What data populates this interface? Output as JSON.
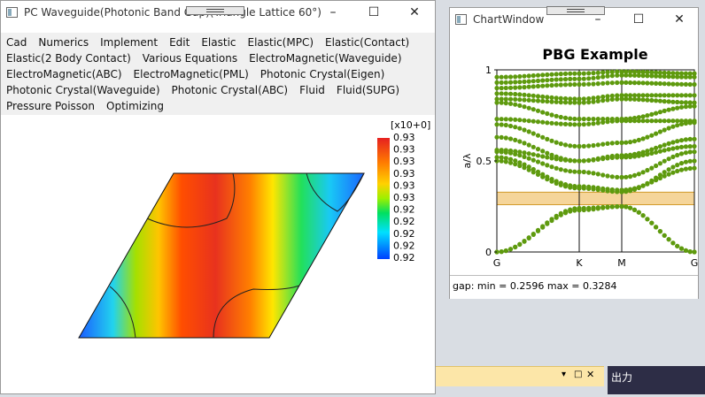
{
  "main_window": {
    "title": "PC Waveguide(Photonic Band Gap)(Triangle Lattice 60°) - I...",
    "menu_rows": [
      [
        "Cad",
        "Numerics",
        "Implement",
        "Edit",
        "Elastic",
        "Elastic(MPC)",
        "Elastic(Contact)"
      ],
      [
        "Elastic(2 Body Contact)",
        "Various Equations",
        "ElectroMagnetic(Waveguide)"
      ],
      [
        "ElectroMagnetic(ABC)",
        "ElectroMagnetic(PML)",
        "Photonic Crystal(Eigen)"
      ],
      [
        "Photonic Crystal(Waveguide)",
        "Photonic Crystal(ABC)",
        "Fluid",
        "Fluid(SUPG)"
      ],
      [
        "Pressure Poisson",
        "Optimizing"
      ]
    ],
    "colorbar": {
      "exponent_label": "[x10+0]",
      "tick_labels": [
        "0.93",
        "0.93",
        "0.93",
        "0.93",
        "0.93",
        "0.93",
        "0.92",
        "0.92",
        "0.92",
        "0.92",
        "0.92"
      ],
      "colors": [
        "#e62020",
        "#ff7a00",
        "#ffd200",
        "#9cf000",
        "#00e060",
        "#00e0ff",
        "#0040ff"
      ]
    }
  },
  "chart_window": {
    "title": "ChartWindow",
    "status_text": "gap: min = 0.2596 max = 0.3284"
  },
  "chart_data": {
    "type": "scatter",
    "title": "PBG Example",
    "ylabel": "a/λ",
    "xlabel": "",
    "x_ticks": [
      "G",
      "K",
      "M",
      "G"
    ],
    "y_ticks": [
      "0",
      "0.5",
      "1"
    ],
    "ylim": [
      0,
      1
    ],
    "band_gap": [
      0.2596,
      0.3284
    ],
    "series_color": "#5e9a0e",
    "gap_color": "#f5d59a",
    "bands": [
      [
        0.0,
        0.23,
        0.25,
        0.0
      ],
      [
        0.0,
        0.24,
        0.25,
        0.0
      ],
      [
        0.5,
        0.35,
        0.33,
        0.5
      ],
      [
        0.52,
        0.36,
        0.34,
        0.46
      ],
      [
        0.55,
        0.44,
        0.41,
        0.55
      ],
      [
        0.56,
        0.5,
        0.52,
        0.58
      ],
      [
        0.63,
        0.5,
        0.53,
        0.62
      ],
      [
        0.7,
        0.58,
        0.6,
        0.71
      ],
      [
        0.73,
        0.7,
        0.72,
        0.72
      ],
      [
        0.82,
        0.73,
        0.73,
        0.8
      ],
      [
        0.84,
        0.82,
        0.84,
        0.82
      ],
      [
        0.87,
        0.84,
        0.86,
        0.86
      ],
      [
        0.9,
        0.92,
        0.93,
        0.92
      ],
      [
        0.93,
        0.95,
        0.97,
        0.96
      ],
      [
        0.96,
        0.98,
        0.99,
        0.98
      ]
    ]
  },
  "background_panel": {
    "label": "出力"
  }
}
